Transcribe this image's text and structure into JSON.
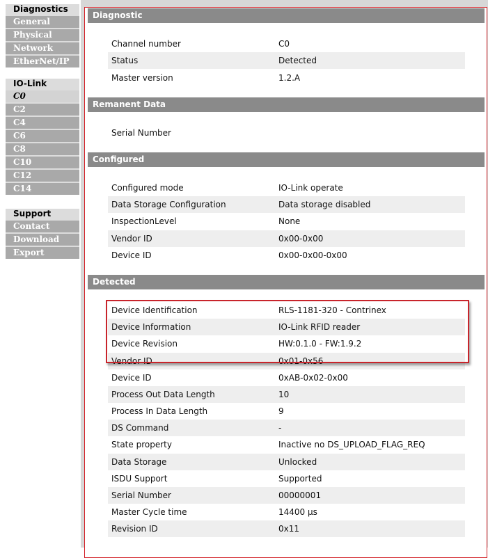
{
  "nav": {
    "diagnostics": {
      "header": "Diagnostics",
      "items": [
        "General",
        "Physical",
        "Network",
        "EtherNet/IP"
      ]
    },
    "iolink": {
      "header": "IO-Link",
      "items": [
        "C0",
        "C2",
        "C4",
        "C6",
        "C8",
        "C10",
        "C12",
        "C14"
      ],
      "active": "C0"
    },
    "support": {
      "header": "Support",
      "items": [
        "Contact",
        "Download",
        "Export"
      ]
    }
  },
  "sections": {
    "diagnostic": {
      "title": "Diagnostic",
      "rows": [
        {
          "label": "Channel number",
          "value": "C0"
        },
        {
          "label": "Status",
          "value": "Detected"
        },
        {
          "label": "Master version",
          "value": "1.2.A"
        }
      ]
    },
    "remanent": {
      "title": "Remanent Data",
      "rows": [
        {
          "label": "Serial Number",
          "value": ""
        }
      ]
    },
    "configured": {
      "title": "Configured",
      "rows": [
        {
          "label": "Configured mode",
          "value": "IO-Link operate"
        },
        {
          "label": "Data Storage Configuration",
          "value": "Data storage disabled"
        },
        {
          "label": "InspectionLevel",
          "value": "None"
        },
        {
          "label": "Vendor ID",
          "value": "0x00-0x00"
        },
        {
          "label": "Device ID",
          "value": "0x00-0x00-0x00"
        }
      ]
    },
    "detected": {
      "title": "Detected",
      "rows": [
        {
          "label": "Device Identification",
          "value": "RLS-1181-320 - Contrinex"
        },
        {
          "label": "Device Information",
          "value": "IO-Link RFID reader"
        },
        {
          "label": "Device Revision",
          "value": "HW:0.1.0 - FW:1.9.2"
        },
        {
          "label": "Vendor ID",
          "value": "0x01-0x56"
        },
        {
          "label": "Device ID",
          "value": "0xAB-0x02-0x00"
        },
        {
          "label": "Process Out Data Length",
          "value": "10"
        },
        {
          "label": "Process In Data Length",
          "value": "9"
        },
        {
          "label": "DS Command",
          "value": "-"
        },
        {
          "label": "State property",
          "value": "Inactive no DS_UPLOAD_FLAG_REQ"
        },
        {
          "label": "Data Storage",
          "value": "Unlocked"
        },
        {
          "label": "ISDU Support",
          "value": "Supported"
        },
        {
          "label": "Serial Number",
          "value": "00000001"
        },
        {
          "label": "Master Cycle time",
          "value": "14400 µs"
        },
        {
          "label": "Revision ID",
          "value": "0x11"
        }
      ]
    }
  },
  "colors": {
    "nav_item_bg": "#a9a9a9",
    "nav_header_bg": "#dcdcdc",
    "section_header_bg": "#8a8a8a",
    "frame_border": "#d21f26",
    "highlight_border": "#c8242b",
    "row_alt_bg": "#eeeeee"
  }
}
